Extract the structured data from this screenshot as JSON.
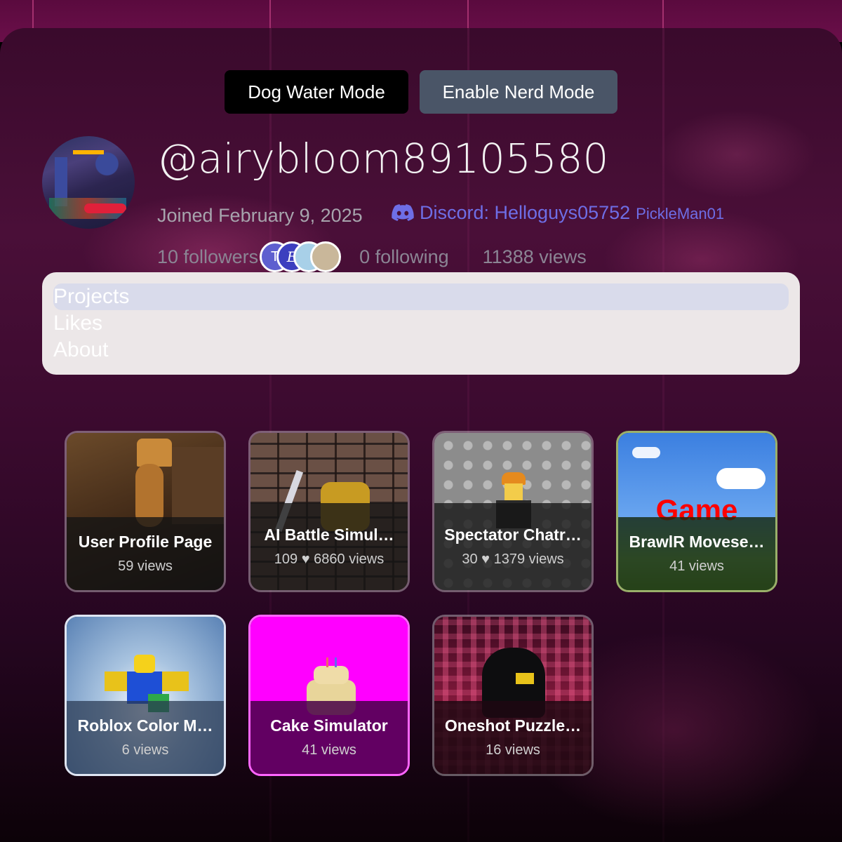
{
  "mode_buttons": {
    "dog_water": "Dog Water Mode",
    "nerd": "Enable Nerd Mode"
  },
  "profile": {
    "username": "@airybloom89105580",
    "joined": "Joined February 9, 2025",
    "discord_label": "Discord: Helloguys05752",
    "discord_alt": "PickleMan01",
    "followers": "10 followers",
    "following": "0 following",
    "views": "11388 views",
    "follower_avatars": [
      {
        "initial": "T",
        "color": "#5e5fcf"
      },
      {
        "initial": "E",
        "color": "#3c3fbf"
      },
      {
        "initial": "",
        "color": "#a8d0e8"
      },
      {
        "initial": "",
        "color": "#c9b79a"
      }
    ]
  },
  "tabs": [
    {
      "label": "Projects",
      "active": true
    },
    {
      "label": "Likes",
      "active": false
    },
    {
      "label": "About",
      "active": false
    }
  ],
  "projects": [
    {
      "title": "User Profile Page",
      "meta": "59 views"
    },
    {
      "title": "AI Battle Simul…",
      "meta": "109 ♥ 6860 views"
    },
    {
      "title": "Spectator Chatr…",
      "meta": "30 ♥ 1379 views"
    },
    {
      "title": "BrawlR Movese…",
      "meta": "41 views",
      "thumb_text": "Game"
    },
    {
      "title": "Roblox Color M…",
      "meta": "6 views"
    },
    {
      "title": "Cake Simulator",
      "meta": "41 views"
    },
    {
      "title": "Oneshot Puzzle…",
      "meta": "16 views"
    }
  ],
  "colors": {
    "discord": "#6e6ee6",
    "nerd_button": "#4a5567",
    "cake_bg": "#ff00ff"
  },
  "icons": [
    "discord-icon"
  ]
}
